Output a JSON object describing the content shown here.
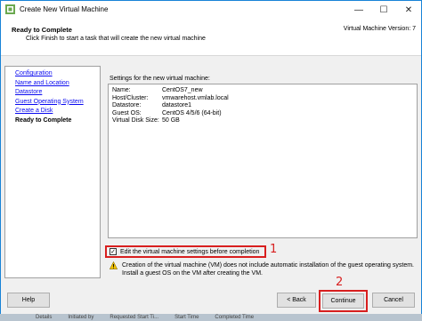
{
  "window": {
    "title": "Create New Virtual Machine",
    "minimize_glyph": "—",
    "maximize_glyph": "☐",
    "close_glyph": "✕"
  },
  "header": {
    "title": "Ready to Complete",
    "subtitle": "Click Finish to start a task that will create the new virtual machine",
    "version": "Virtual Machine Version: 7"
  },
  "nav": {
    "items": [
      {
        "label": "Configuration",
        "current": false
      },
      {
        "label": "Name and Location",
        "current": false
      },
      {
        "label": "Datastore",
        "current": false
      },
      {
        "label": "Guest Operating System",
        "current": false
      },
      {
        "label": "Create a Disk",
        "current": false
      },
      {
        "label": "Ready to Complete",
        "current": true
      }
    ]
  },
  "settings": {
    "label": "Settings for the new virtual machine:",
    "rows": [
      {
        "key": "Name:",
        "value": "CentOS7_new"
      },
      {
        "key": "Host/Cluster:",
        "value": "vmwarehost.vmlab.local"
      },
      {
        "key": "Datastore:",
        "value": "datastore1"
      },
      {
        "key": "Guest OS:",
        "value": "CentOS 4/5/6 (64-bit)"
      },
      {
        "key": "Virtual Disk Size:",
        "value": "50 GB"
      }
    ]
  },
  "edit_checkbox": {
    "label": "Edit the virtual machine settings before completion",
    "checked": true,
    "check_glyph": "✓"
  },
  "annotations": {
    "marker1": "1",
    "marker2": "2"
  },
  "warning": {
    "icon": "warning-icon",
    "text": "Creation of the virtual machine (VM) does not include automatic installation of the guest operating system. Install a guest OS on the VM after creating the VM."
  },
  "buttons": {
    "help": "Help",
    "back": "< Back",
    "continue": "Continue",
    "cancel": "Cancel"
  },
  "colors": {
    "accent": "#1883d7",
    "link": "#0a0af0",
    "highlight": "#d81f1f"
  },
  "bottom_strip": {
    "items": [
      "Details",
      "Initiated by",
      "Requested Start Ti...",
      "Start Time",
      "Completed Time"
    ]
  }
}
